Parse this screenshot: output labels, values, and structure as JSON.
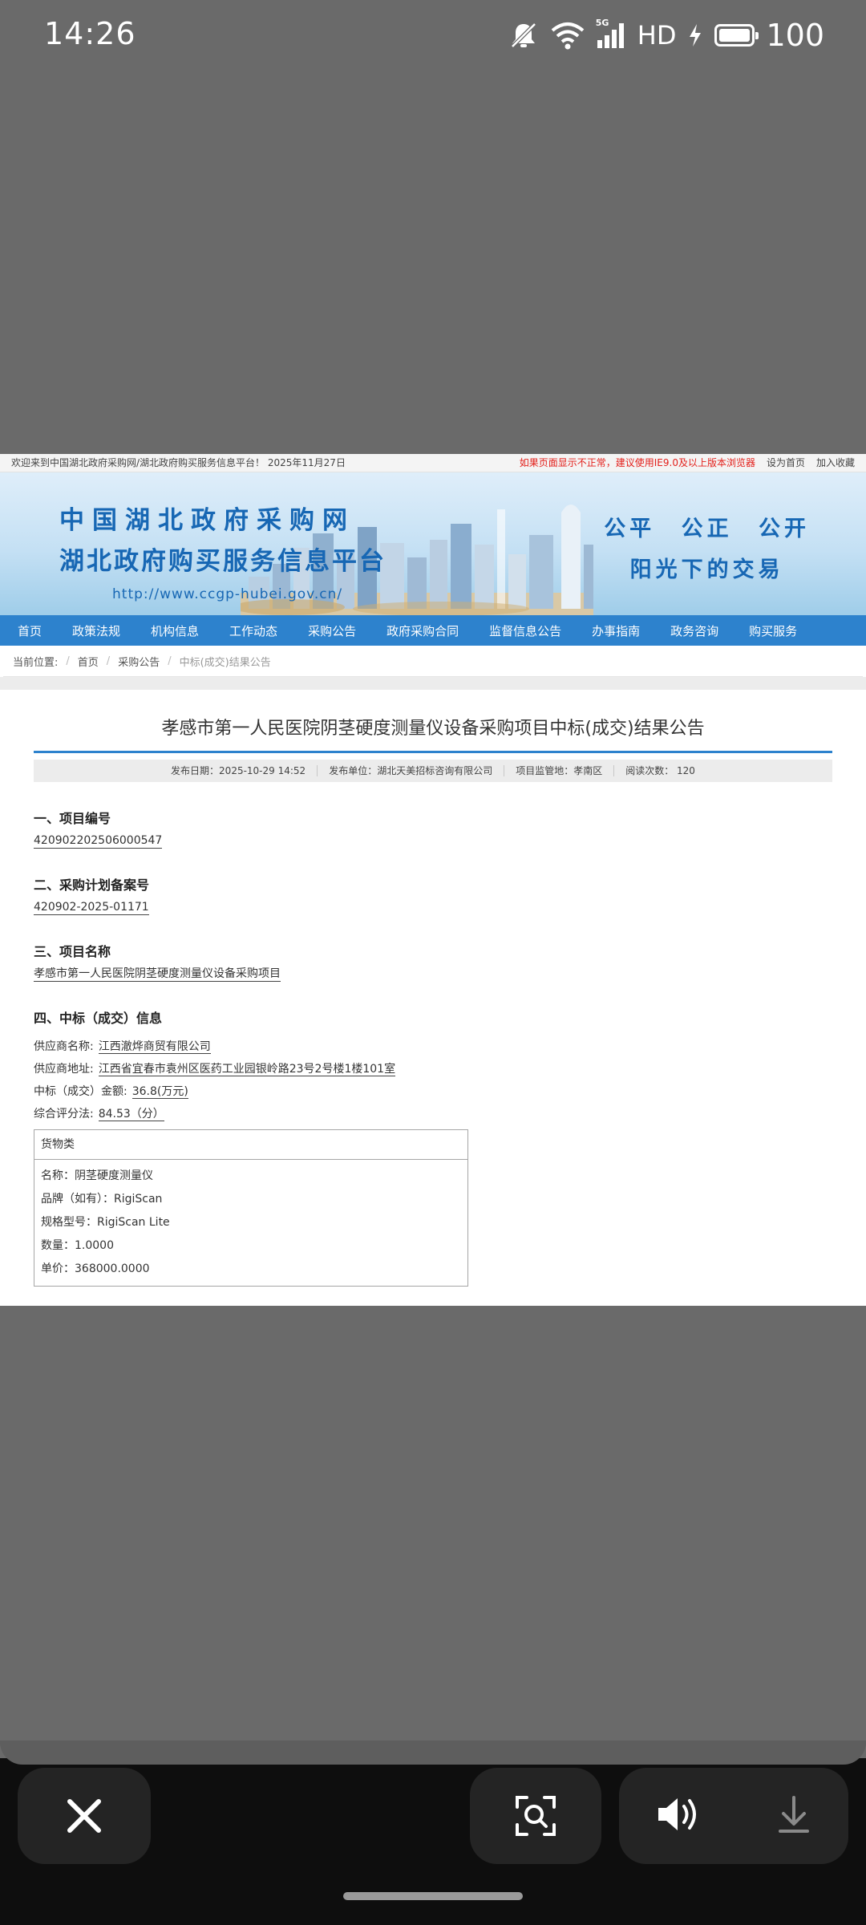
{
  "status_bar": {
    "time": "14:26",
    "network": "5G",
    "hd": "HD",
    "battery": "100"
  },
  "webpage": {
    "topbar": {
      "welcome": "欢迎来到中国湖北政府采购网/湖北政府购买服务信息平台！ 2025年11月27日",
      "warning": "如果页面显示不正常，建议使用IE9.0及以上版本浏览器",
      "set_home": "设为首页",
      "favorite": "加入收藏"
    },
    "banner": {
      "title_line1": "中国湖北政府采购网",
      "title_line2": "湖北政府购买服务信息平台",
      "url": "http://www.ccgp-hubei.gov.cn/",
      "slogan_line1": "公平 公正 公开",
      "slogan_line2": "阳光下的交易"
    },
    "nav": [
      "首页",
      "政策法规",
      "机构信息",
      "工作动态",
      "采购公告",
      "政府采购合同",
      "监督信息公告",
      "办事指南",
      "政务咨询",
      "购买服务"
    ],
    "breadcrumb": {
      "label": "当前位置:",
      "home": "首页",
      "section": "采购公告",
      "current": "中标(成交)结果公告"
    },
    "article": {
      "title": "孝感市第一人民医院阴茎硬度测量仪设备采购项目中标(成交)结果公告",
      "meta": {
        "publish_date": "发布日期：2025-10-29 14:52",
        "publisher": "发布单位：湖北天美招标咨询有限公司",
        "region": "项目监管地：孝南区",
        "views": "阅读次数：  120"
      },
      "section1": {
        "heading": "一、项目编号",
        "value": "420902202506000547"
      },
      "section2": {
        "heading": "二、采购计划备案号",
        "value": "420902-2025-01171"
      },
      "section3": {
        "heading": "三、项目名称",
        "value": "孝感市第一人民医院阴茎硬度测量仪设备采购项目"
      },
      "section4": {
        "heading": "四、中标（成交）信息",
        "supplier_name_label": "供应商名称:",
        "supplier_name": "江西澈烨商贸有限公司",
        "supplier_address_label": "供应商地址:",
        "supplier_address": "江西省宜春市袁州区医药工业园银岭路23号2号楼1楼101室",
        "amount_label": "中标（成交）金额:",
        "amount": "36.8(万元)",
        "score_label": "综合评分法:",
        "score": "84.53（分）",
        "goods": {
          "header": "货物类",
          "rows": [
            "名称：阴茎硬度测量仪",
            "品牌（如有）：RigiScan",
            "规格型号：RigiScan Lite",
            "数量：1.0000",
            "单价：368000.0000"
          ]
        }
      }
    }
  }
}
